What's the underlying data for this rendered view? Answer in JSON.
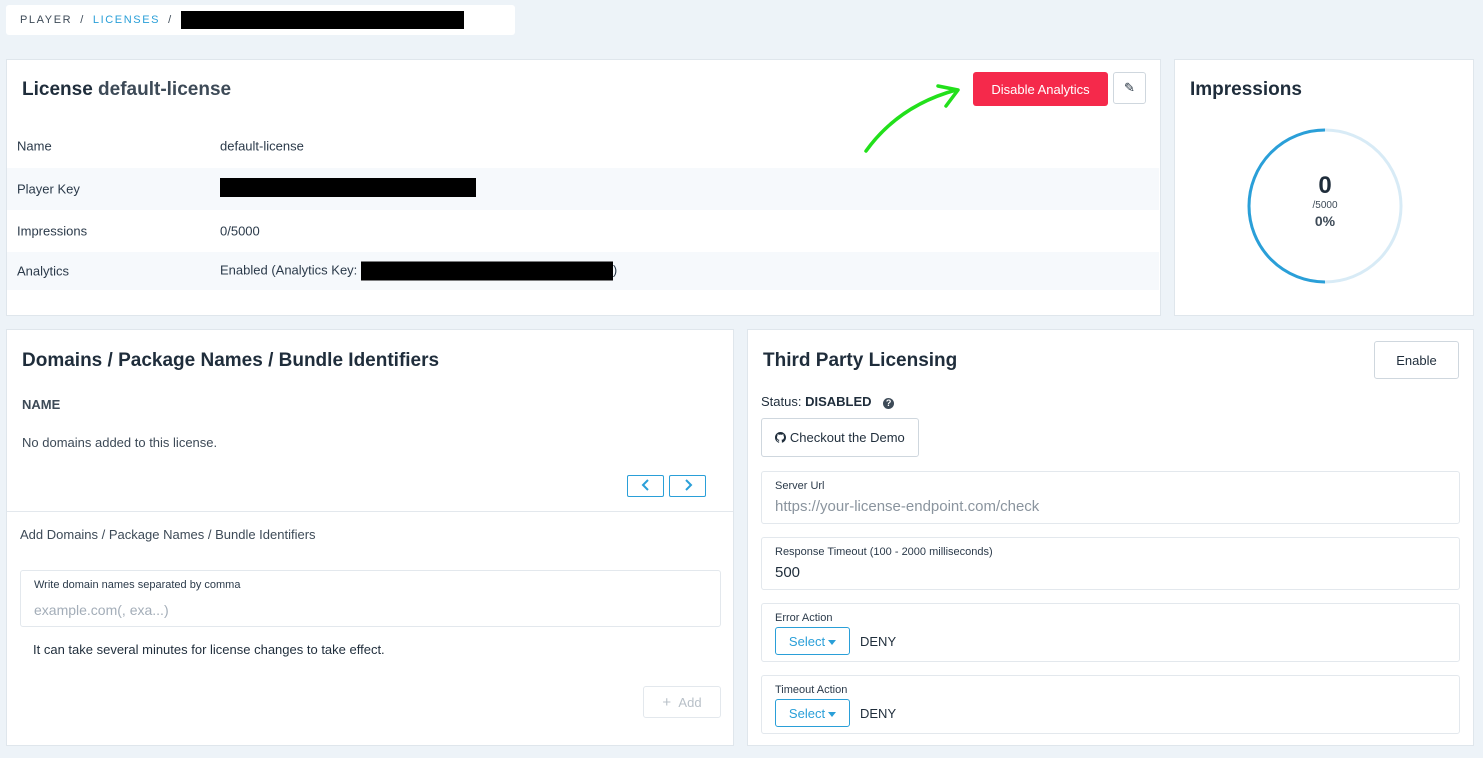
{
  "breadcrumb": {
    "root": "PLAYER",
    "section": "LICENSES",
    "sep": "/"
  },
  "license": {
    "title_prefix": "License",
    "title_name": "default-license",
    "disable_button": "Disable Analytics",
    "rows": [
      {
        "key": "Name",
        "value": "default-license"
      },
      {
        "key": "Player Key",
        "value": ""
      },
      {
        "key": "Impressions",
        "value": "0/5000"
      },
      {
        "key": "Analytics",
        "value_prefix": "Enabled (Analytics Key:",
        "value_suffix": ")"
      }
    ]
  },
  "impressions": {
    "title": "Impressions",
    "count": "0",
    "limit": "/5000",
    "percent": "0%",
    "fraction": 0.0,
    "accent": "#2a9fd8",
    "track": "#d8ebf6"
  },
  "domains": {
    "title": "Domains / Package Names / Bundle Identifiers",
    "column": "NAME",
    "empty": "No domains added to this license.",
    "add_title": "Add Domains / Package Names / Bundle Identifiers",
    "input_label": "Write domain names separated by comma",
    "input_placeholder": "example.com(, exa...)",
    "note": "It can take several minutes for license changes to take effect.",
    "add_button": "Add"
  },
  "third_party": {
    "title": "Third Party Licensing",
    "enable_button": "Enable",
    "status_label": "Status:",
    "status_value": "DISABLED",
    "demo_button": "Checkout the Demo",
    "server_url_label": "Server Url",
    "server_url_placeholder": "https://your-license-endpoint.com/check",
    "timeout_label": "Response Timeout (100 - 2000 milliseconds)",
    "timeout_value": "500",
    "error_action_label": "Error Action",
    "error_action_value": "DENY",
    "timeout_action_label": "Timeout Action",
    "timeout_action_value": "DENY",
    "select_label": "Select"
  },
  "colors": {
    "danger": "#f5294b",
    "accent": "#2a9fd8",
    "arrow": "#22e01b"
  }
}
